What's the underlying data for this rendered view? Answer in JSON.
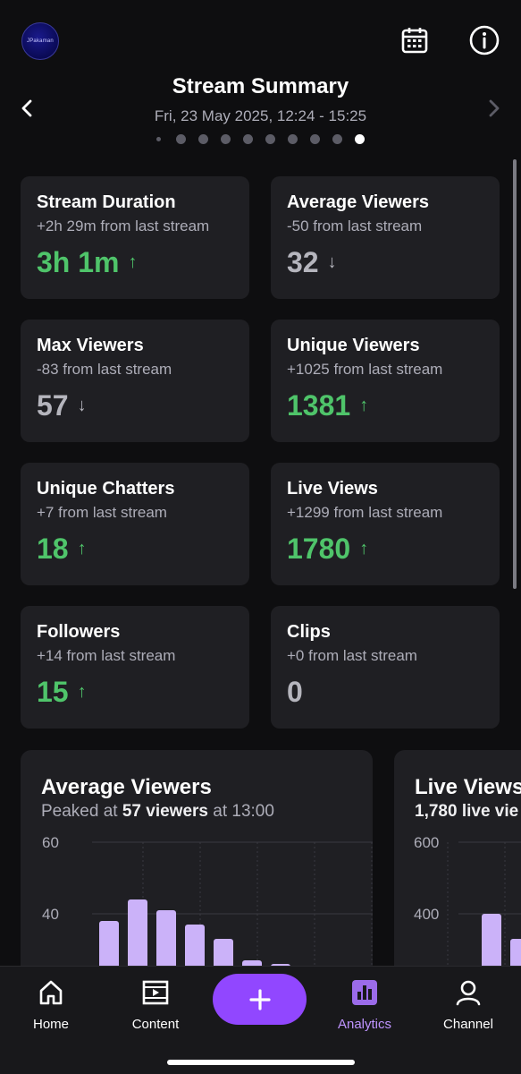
{
  "channel": {
    "avatar_text": "JPakaman"
  },
  "header": {
    "title": "Stream Summary",
    "subtitle": "Fri, 23 May 2025, 12:24 - 15:25",
    "page_count": 10,
    "active_page": 10
  },
  "stats": [
    {
      "label": "Stream Duration",
      "change": "+2h 29m from last stream",
      "value": "3h 1m",
      "trend": "up"
    },
    {
      "label": "Average Viewers",
      "change": "-50 from last stream",
      "value": "32",
      "trend": "down"
    },
    {
      "label": "Max Viewers",
      "change": "-83 from last stream",
      "value": "57",
      "trend": "down"
    },
    {
      "label": "Unique Viewers",
      "change": "+1025 from last stream",
      "value": "1381",
      "trend": "up"
    },
    {
      "label": "Unique Chatters",
      "change": "+7 from last stream",
      "value": "18",
      "trend": "up"
    },
    {
      "label": "Live Views",
      "change": "+1299 from last stream",
      "value": "1780",
      "trend": "up"
    },
    {
      "label": "Followers",
      "change": "+14 from last stream",
      "value": "15",
      "trend": "up"
    },
    {
      "label": "Clips",
      "change": "+0 from last stream",
      "value": "0",
      "trend": "flat"
    }
  ],
  "charts": [
    {
      "title": "Average Viewers",
      "subtitle_prefix": "Peaked at ",
      "subtitle_bold": "57 viewers",
      "subtitle_suffix": " at 13:00"
    },
    {
      "title": "Live Views",
      "subtitle_prefix": "",
      "subtitle_bold": "1,780 live vie",
      "subtitle_suffix": ""
    }
  ],
  "chart_data": [
    {
      "type": "bar",
      "title": "Average Viewers",
      "yticks": [
        40,
        60
      ],
      "ylim": [
        20,
        60
      ],
      "values": [
        20,
        38,
        44,
        41,
        37,
        33,
        27,
        26,
        20
      ],
      "color": "#cbb2f9"
    },
    {
      "type": "bar",
      "title": "Live Views",
      "yticks": [
        400,
        600
      ],
      "ylim": [
        200,
        600
      ],
      "values": [
        200,
        400,
        330
      ],
      "color": "#cbb2f9"
    }
  ],
  "tabs": [
    {
      "label": "Home",
      "icon": "home-icon",
      "active": false
    },
    {
      "label": "Content",
      "icon": "film-icon",
      "active": false
    },
    {
      "label": "Analytics",
      "icon": "bar-chart-icon",
      "active": true
    },
    {
      "label": "Channel",
      "icon": "person-icon",
      "active": false
    }
  ],
  "colors": {
    "accent": "#9147ff",
    "positive": "#4fc46a",
    "bar": "#cbb2f9",
    "card": "#1f1f23"
  }
}
